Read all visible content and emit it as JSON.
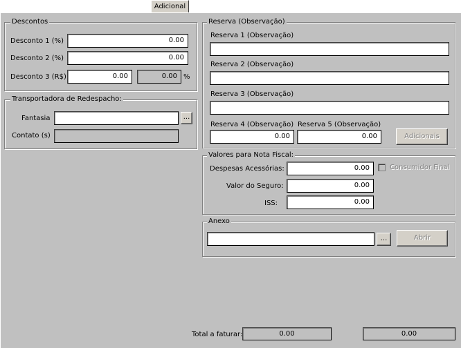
{
  "tab": {
    "label": "Adicional"
  },
  "descontos": {
    "title": "Descontos",
    "d1_label": "Desconto 1  (%)",
    "d1_value": "0.00",
    "d2_label": "Desconto 2  (%)",
    "d2_value": "0.00",
    "d3_label": "Desconto 3 (R$)",
    "d3_value": "0.00",
    "d3_percent_value": "0.00",
    "percent_symbol": "%"
  },
  "transportadora": {
    "title": "Transportadora de Redespacho:",
    "fantasia_label": "Fantasia",
    "fantasia_value": "",
    "browse_label": "...",
    "contato_label": "Contato (s)",
    "contato_value": ""
  },
  "reserva": {
    "title": "Reserva (Observação)",
    "r1_label": "Reserva 1 (Observação)",
    "r1_value": "",
    "r2_label": "Reserva 2 (Observação)",
    "r2_value": "",
    "r3_label": "Reserva 3 (Observação)",
    "r3_value": "",
    "r4_label": "Reserva 4 (Observação)",
    "r4_value": "0.00",
    "r5_label": "Reserva 5 (Observação)",
    "r5_value": "0.00",
    "adicionais_label": "Adicionais"
  },
  "nota": {
    "title": "Valores para Nota Fiscal:",
    "despesas_label": "Despesas Acessórias:",
    "despesas_value": "0.00",
    "consumidor_label": "Consumidor Final",
    "seguro_label": "Valor do Seguro:",
    "seguro_value": "0.00",
    "iss_label": "ISS:",
    "iss_value": "0.00"
  },
  "anexo": {
    "title": "Anexo",
    "value": "",
    "browse_label": "...",
    "abrir_label": "Abrir"
  },
  "footer": {
    "total_label": "Total a faturar:",
    "total_value": "0.00",
    "second_value": "0.00"
  }
}
